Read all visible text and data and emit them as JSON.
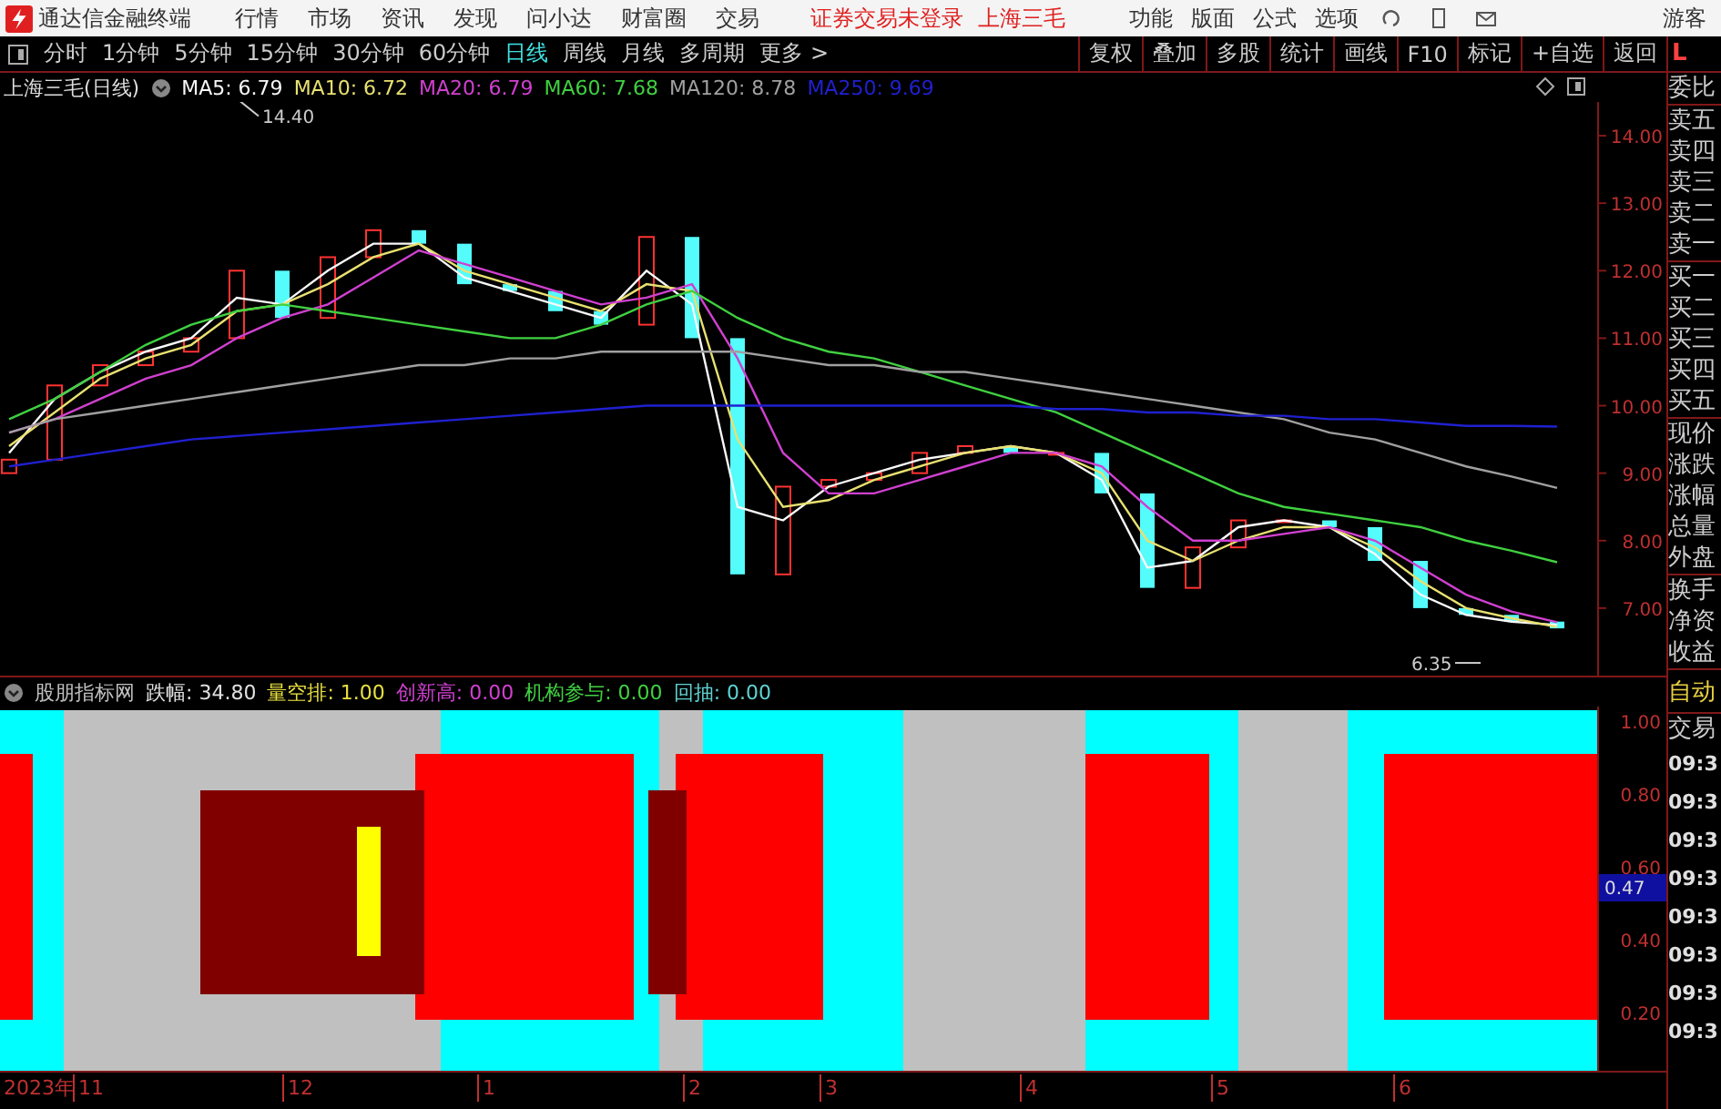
{
  "menubar": {
    "title": "通达信金融终端",
    "menus": [
      "行情",
      "市场",
      "资讯",
      "发现",
      "问小达",
      "财富圈",
      "交易"
    ],
    "status": [
      "证券交易未登录",
      "上海三毛"
    ],
    "tools": [
      "功能",
      "版面",
      "公式",
      "选项"
    ],
    "user": "游客"
  },
  "toolbar": {
    "periods": [
      {
        "label": "分时",
        "selected": false
      },
      {
        "label": "1分钟",
        "selected": false
      },
      {
        "label": "5分钟",
        "selected": false
      },
      {
        "label": "15分钟",
        "selected": false
      },
      {
        "label": "30分钟",
        "selected": false
      },
      {
        "label": "60分钟",
        "selected": false
      },
      {
        "label": "日线",
        "selected": true
      },
      {
        "label": "周线",
        "selected": false
      },
      {
        "label": "月线",
        "selected": false
      },
      {
        "label": "多周期",
        "selected": false
      },
      {
        "label": "更多 >",
        "selected": false
      }
    ],
    "buttons": [
      "复权",
      "叠加",
      "多股",
      "统计",
      "画线",
      "F10",
      "标记",
      "+自选",
      "返回"
    ]
  },
  "price_panel": {
    "title": "上海三毛(日线)",
    "chart_data": {
      "type": "line",
      "ylim": [
        6,
        14.5
      ],
      "yticks": [
        {
          "value": 7,
          "label": "7.00"
        },
        {
          "value": 8,
          "label": "8.00"
        },
        {
          "value": 9,
          "label": "9.00"
        },
        {
          "value": 10,
          "label": "10.00"
        },
        {
          "value": 11,
          "label": "11.00"
        },
        {
          "value": 12,
          "label": "12.00"
        },
        {
          "value": 13,
          "label": "13.00"
        },
        {
          "value": 14,
          "label": "14.00"
        }
      ],
      "series": [
        {
          "name": "MA5: 6.79",
          "color": "#f8f8f8",
          "values": [
            9.3,
            10.1,
            10.5,
            10.8,
            11.0,
            11.6,
            11.5,
            12.0,
            12.4,
            12.4,
            11.9,
            11.7,
            11.5,
            11.3,
            12.0,
            11.5,
            8.5,
            8.3,
            8.8,
            9.0,
            9.2,
            9.3,
            9.4,
            9.3,
            8.9,
            7.6,
            7.7,
            8.2,
            8.3,
            8.2,
            7.8,
            7.2,
            6.9,
            6.8,
            6.75
          ]
        },
        {
          "name": "MA10: 6.72",
          "color": "#e8e070",
          "values": [
            9.4,
            9.9,
            10.4,
            10.7,
            10.9,
            11.4,
            11.5,
            11.8,
            12.2,
            12.4,
            12.0,
            11.8,
            11.6,
            11.4,
            11.8,
            11.7,
            9.5,
            8.5,
            8.6,
            8.9,
            9.1,
            9.3,
            9.4,
            9.3,
            9.0,
            8.0,
            7.7,
            8.0,
            8.2,
            8.2,
            7.9,
            7.4,
            7.0,
            6.85,
            6.72
          ]
        },
        {
          "name": "MA20: 6.79",
          "color": "#d040d0",
          "values": [
            9.6,
            9.8,
            10.1,
            10.4,
            10.6,
            11.0,
            11.3,
            11.5,
            11.9,
            12.3,
            12.1,
            11.9,
            11.7,
            11.5,
            11.6,
            11.8,
            10.7,
            9.3,
            8.7,
            8.7,
            8.9,
            9.1,
            9.3,
            9.3,
            9.1,
            8.5,
            8.0,
            8.0,
            8.1,
            8.2,
            8.0,
            7.6,
            7.2,
            6.95,
            6.79
          ]
        },
        {
          "name": "MA60: 7.68",
          "color": "#40d040",
          "values": [
            9.8,
            10.1,
            10.5,
            10.9,
            11.2,
            11.4,
            11.5,
            11.4,
            11.3,
            11.2,
            11.1,
            11.0,
            11.0,
            11.2,
            11.5,
            11.7,
            11.3,
            11.0,
            10.8,
            10.7,
            10.5,
            10.3,
            10.1,
            9.9,
            9.6,
            9.3,
            9.0,
            8.7,
            8.5,
            8.4,
            8.3,
            8.2,
            8.0,
            7.85,
            7.68
          ]
        },
        {
          "name": "MA120: 8.78",
          "color": "#a0a0a0",
          "values": [
            9.6,
            9.8,
            9.9,
            10.0,
            10.1,
            10.2,
            10.3,
            10.4,
            10.5,
            10.6,
            10.6,
            10.7,
            10.7,
            10.8,
            10.8,
            10.8,
            10.8,
            10.7,
            10.6,
            10.6,
            10.5,
            10.5,
            10.4,
            10.3,
            10.2,
            10.1,
            10.0,
            9.9,
            9.8,
            9.6,
            9.5,
            9.3,
            9.1,
            8.95,
            8.78
          ]
        },
        {
          "name": "MA250: 9.69",
          "color": "#2020d0",
          "values": [
            9.1,
            9.2,
            9.3,
            9.4,
            9.5,
            9.55,
            9.6,
            9.65,
            9.7,
            9.75,
            9.8,
            9.85,
            9.9,
            9.95,
            10.0,
            10.0,
            10.0,
            10.0,
            10.0,
            10.0,
            10.0,
            10.0,
            10.0,
            9.95,
            9.95,
            9.9,
            9.9,
            9.85,
            9.85,
            9.8,
            9.8,
            9.75,
            9.7,
            9.7,
            9.69
          ]
        }
      ],
      "annotations": [
        {
          "text": "14.40"
        },
        {
          "text": "6.35"
        }
      ]
    }
  },
  "indicator": {
    "legend": [
      {
        "label": "股朋指标网",
        "color": "#c0c0c0"
      },
      {
        "label": "跌幅: 34.80",
        "color": "#e0e0e0"
      },
      {
        "label": "量空排: 1.00",
        "color": "#e8e040"
      },
      {
        "label": "创新高: 0.00",
        "color": "#d040d0"
      },
      {
        "label": "机构参与: 0.00",
        "color": "#40d040"
      },
      {
        "label": "回抽: 0.00",
        "color": "#60d0d0"
      }
    ],
    "axis_labels": [
      "1.00",
      "0.80",
      "0.60",
      "0.40",
      "0.20"
    ],
    "cursor_value": "0.47"
  },
  "date_axis": {
    "year": "2023年",
    "months": [
      "11",
      "12",
      "1",
      "2",
      "3",
      "4",
      "5",
      "6"
    ]
  },
  "quote_panel": {
    "header": "L",
    "groups": [
      [
        "委比"
      ],
      [
        "卖五",
        "卖四",
        "卖三",
        "卖二",
        "卖一"
      ],
      [
        "买一",
        "买二",
        "买三",
        "买四",
        "买五"
      ],
      [
        "现价",
        "涨跌",
        "涨幅",
        "总量",
        "外盘"
      ],
      [
        "换手",
        "净资",
        "收益"
      ]
    ]
  },
  "trade_panel": {
    "mode": "自动",
    "header": "交易",
    "times": [
      "09:3",
      "09:3",
      "09:3",
      "09:3",
      "09:3",
      "09:3",
      "09:3",
      "09:3"
    ]
  }
}
